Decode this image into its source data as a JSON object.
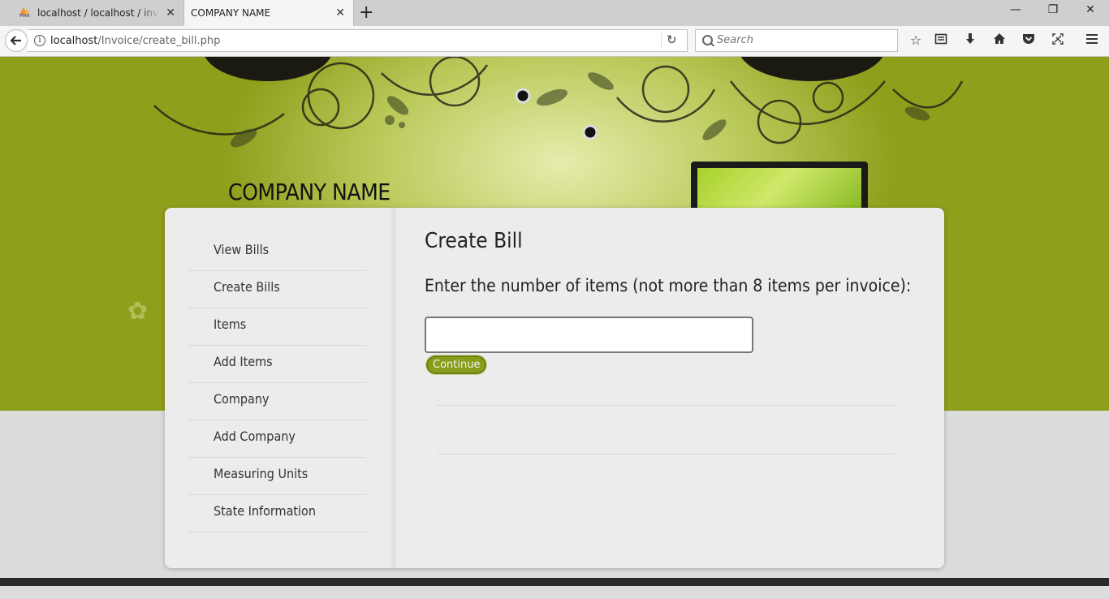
{
  "browser": {
    "tabs": [
      {
        "label": "localhost / localhost / invoic",
        "active": false,
        "favicon": "phpmyadmin-icon"
      },
      {
        "label": "COMPANY NAME",
        "active": true
      }
    ],
    "close_glyph": "✕",
    "new_tab_glyph": "+",
    "window_controls": {
      "minimize": "—",
      "restore": "❐",
      "close": "✕"
    },
    "url": {
      "host": "localhost",
      "path": "/Invoice/create_bill.php"
    },
    "search_placeholder": "Search",
    "toolbar_icons": [
      "bookmark-star-icon",
      "reader-list-icon",
      "download-icon",
      "home-icon",
      "pocket-icon",
      "screenshot-icon",
      "menu-icon"
    ]
  },
  "site": {
    "company_name": "COMPANY NAME",
    "accent_color": "#8f9e1b"
  },
  "sidebar": {
    "items": [
      {
        "label": "View Bills"
      },
      {
        "label": "Create Bills"
      },
      {
        "label": "Items"
      },
      {
        "label": "Add Items"
      },
      {
        "label": "Company"
      },
      {
        "label": "Add Company"
      },
      {
        "label": "Measuring Units"
      },
      {
        "label": "State Information"
      }
    ]
  },
  "main": {
    "title": "Create Bill",
    "prompt": "Enter the number of items (not more than 8 items per invoice):",
    "input_value": "",
    "continue_label": "Continue"
  }
}
